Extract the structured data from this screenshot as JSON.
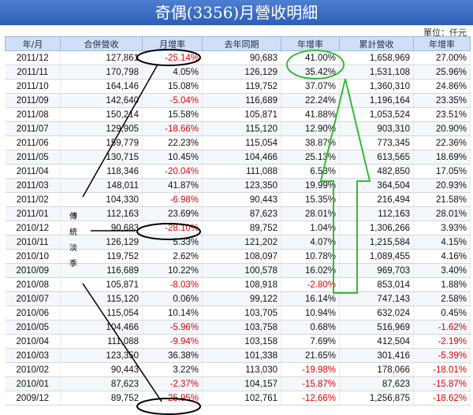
{
  "title": "奇偶(3356)月營收明細",
  "unit": "單位：仟元",
  "columns": [
    "年/月",
    "合併營收",
    "月增率",
    "去年同期",
    "年增率",
    "累計營收",
    "年增率"
  ],
  "rows": [
    [
      "2011/12",
      "127,861",
      "-25.14%",
      "90,683",
      "41.00%",
      "1,658,969",
      "27.00%"
    ],
    [
      "2011/11",
      "170,798",
      "4.05%",
      "126,129",
      "35.42%",
      "1,531,108",
      "25.96%"
    ],
    [
      "2011/10",
      "164,146",
      "15.08%",
      "119,752",
      "37.07%",
      "1,360,310",
      "24.86%"
    ],
    [
      "2011/09",
      "142,640",
      "-5.04%",
      "116,689",
      "22.24%",
      "1,196,164",
      "23.35%"
    ],
    [
      "2011/08",
      "150,214",
      "15.58%",
      "105,871",
      "41.88%",
      "1,053,524",
      "23.51%"
    ],
    [
      "2011/07",
      "129,905",
      "-18.66%",
      "115,120",
      "12.90%",
      "903,310",
      "20.90%"
    ],
    [
      "2011/06",
      "159,779",
      "22.23%",
      "115,054",
      "38.87%",
      "773,345",
      "22.36%"
    ],
    [
      "2011/05",
      "130,715",
      "10.45%",
      "104,466",
      "25.13%",
      "613,565",
      "18.69%"
    ],
    [
      "2011/04",
      "118,346",
      "-20.04%",
      "111,088",
      "6.53%",
      "482,850",
      "17.05%"
    ],
    [
      "2011/03",
      "148,011",
      "41.87%",
      "123,350",
      "19.99%",
      "364,504",
      "20.93%"
    ],
    [
      "2011/02",
      "104,330",
      "-6.98%",
      "90,443",
      "15.35%",
      "216,494",
      "21.58%"
    ],
    [
      "2011/01",
      "112,163",
      "23.69%",
      "87,623",
      "28.01%",
      "112,163",
      "28.01%"
    ],
    [
      "2010/12",
      "90,683",
      "-28.10%",
      "89,752",
      "1.04%",
      "1,306,266",
      "3.93%"
    ],
    [
      "2010/11",
      "126,129",
      "5.33%",
      "121,202",
      "4.07%",
      "1,215,584",
      "4.15%"
    ],
    [
      "2010/10",
      "119,752",
      "2.62%",
      "108,097",
      "10.78%",
      "1,089,455",
      "4.16%"
    ],
    [
      "2010/09",
      "116,689",
      "10.22%",
      "100,578",
      "16.02%",
      "969,703",
      "3.40%"
    ],
    [
      "2010/08",
      "105,871",
      "-8.03%",
      "108,918",
      "-2.80%",
      "853,014",
      "1.88%"
    ],
    [
      "2010/07",
      "115,120",
      "0.06%",
      "99,122",
      "16.14%",
      "747,143",
      "2.58%"
    ],
    [
      "2010/06",
      "115,054",
      "10.14%",
      "103,705",
      "10.94%",
      "632,024",
      "0.45%"
    ],
    [
      "2010/05",
      "104,466",
      "-5.96%",
      "103,758",
      "0.68%",
      "516,969",
      "-1.62%"
    ],
    [
      "2010/04",
      "111,088",
      "-9.94%",
      "103,158",
      "7.69%",
      "412,504",
      "-2.19%"
    ],
    [
      "2010/03",
      "123,350",
      "36.38%",
      "101,338",
      "21.65%",
      "301,416",
      "-5.39%"
    ],
    [
      "2010/02",
      "90,443",
      "3.22%",
      "113,030",
      "-19.98%",
      "178,066",
      "-18.01%"
    ],
    [
      "2010/01",
      "87,623",
      "-2.37%",
      "104,157",
      "-15.87%",
      "87,623",
      "-15.87%"
    ],
    [
      "2009/12",
      "89,752",
      "-25.95%",
      "102,761",
      "-12.66%",
      "1,256,875",
      "-18.62%"
    ]
  ],
  "annotation_chars": [
    "傳",
    "統",
    "淡",
    "季"
  ],
  "colors": {
    "negative": "#e00000",
    "header_bg": "#cfe0f6",
    "title_bg": "#2f5fb5",
    "annotation_green": "#33bb33"
  }
}
